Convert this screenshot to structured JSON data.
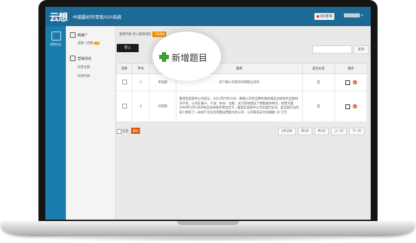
{
  "header": {
    "logo": "云想",
    "app_title": "中國最好的零售020系統",
    "qq_label": "QQ咨询",
    "user_caret": "▾"
  },
  "leftbar": {
    "icon": "app-icon",
    "label": "营销活动"
  },
  "sidebar": {
    "section1": {
      "title": "微推广",
      "icon": "share-icon",
      "items": [
        "美图",
        "|",
        "店铺",
        "hot"
      ]
    },
    "section2": {
      "title": "营销活动",
      "icon": "calendar-icon",
      "items": [
        "问卷主题",
        "问卷列表"
      ]
    }
  },
  "content": {
    "breadcrumb": "题目列表 导入题目请先",
    "breadcrumb_button": "下载模板",
    "import_label": "导入",
    "add_label": "新增题目",
    "search_placeholder": "",
    "search_label": "查询",
    "columns": [
      "选择",
      "序号",
      "",
      "题目",
      "是否必答",
      "操作"
    ],
    "rows": [
      {
        "index": "1",
        "type": "单选题",
        "title": "您了解公司现在的销售业务吗",
        "required": "是"
      },
      {
        "index": "0",
        "type": "问答题",
        "title": "嘉澳至美软件公司成立，2012年5月31日，嘉献公司完全拥有微商城自主研发的全部知识产权，公司在嘉兴、宁波、杭州、合肥、武汉等地建设了销售服务网点，经营方面2009年1月1日开始自主研发并营运至今，嘉澳至美软件公司全国行业内，是全国行业内较少拥有了一站式产业化及完整运营能力的公司，公司目前支付总额超 10 亿元",
        "required": "是"
      }
    ],
    "footer": {
      "select_all": "全选",
      "delete_label": "删除",
      "pager": [
        "2条记录",
        "第1页",
        "共1页",
        "上一页",
        "下一页"
      ]
    }
  },
  "colors": {
    "header_blue": "#1e6a96",
    "left_blue": "#1b7cae",
    "accent_orange": "#f08a00",
    "delete_red": "#e0550f",
    "add_green": "#3fa63a"
  }
}
